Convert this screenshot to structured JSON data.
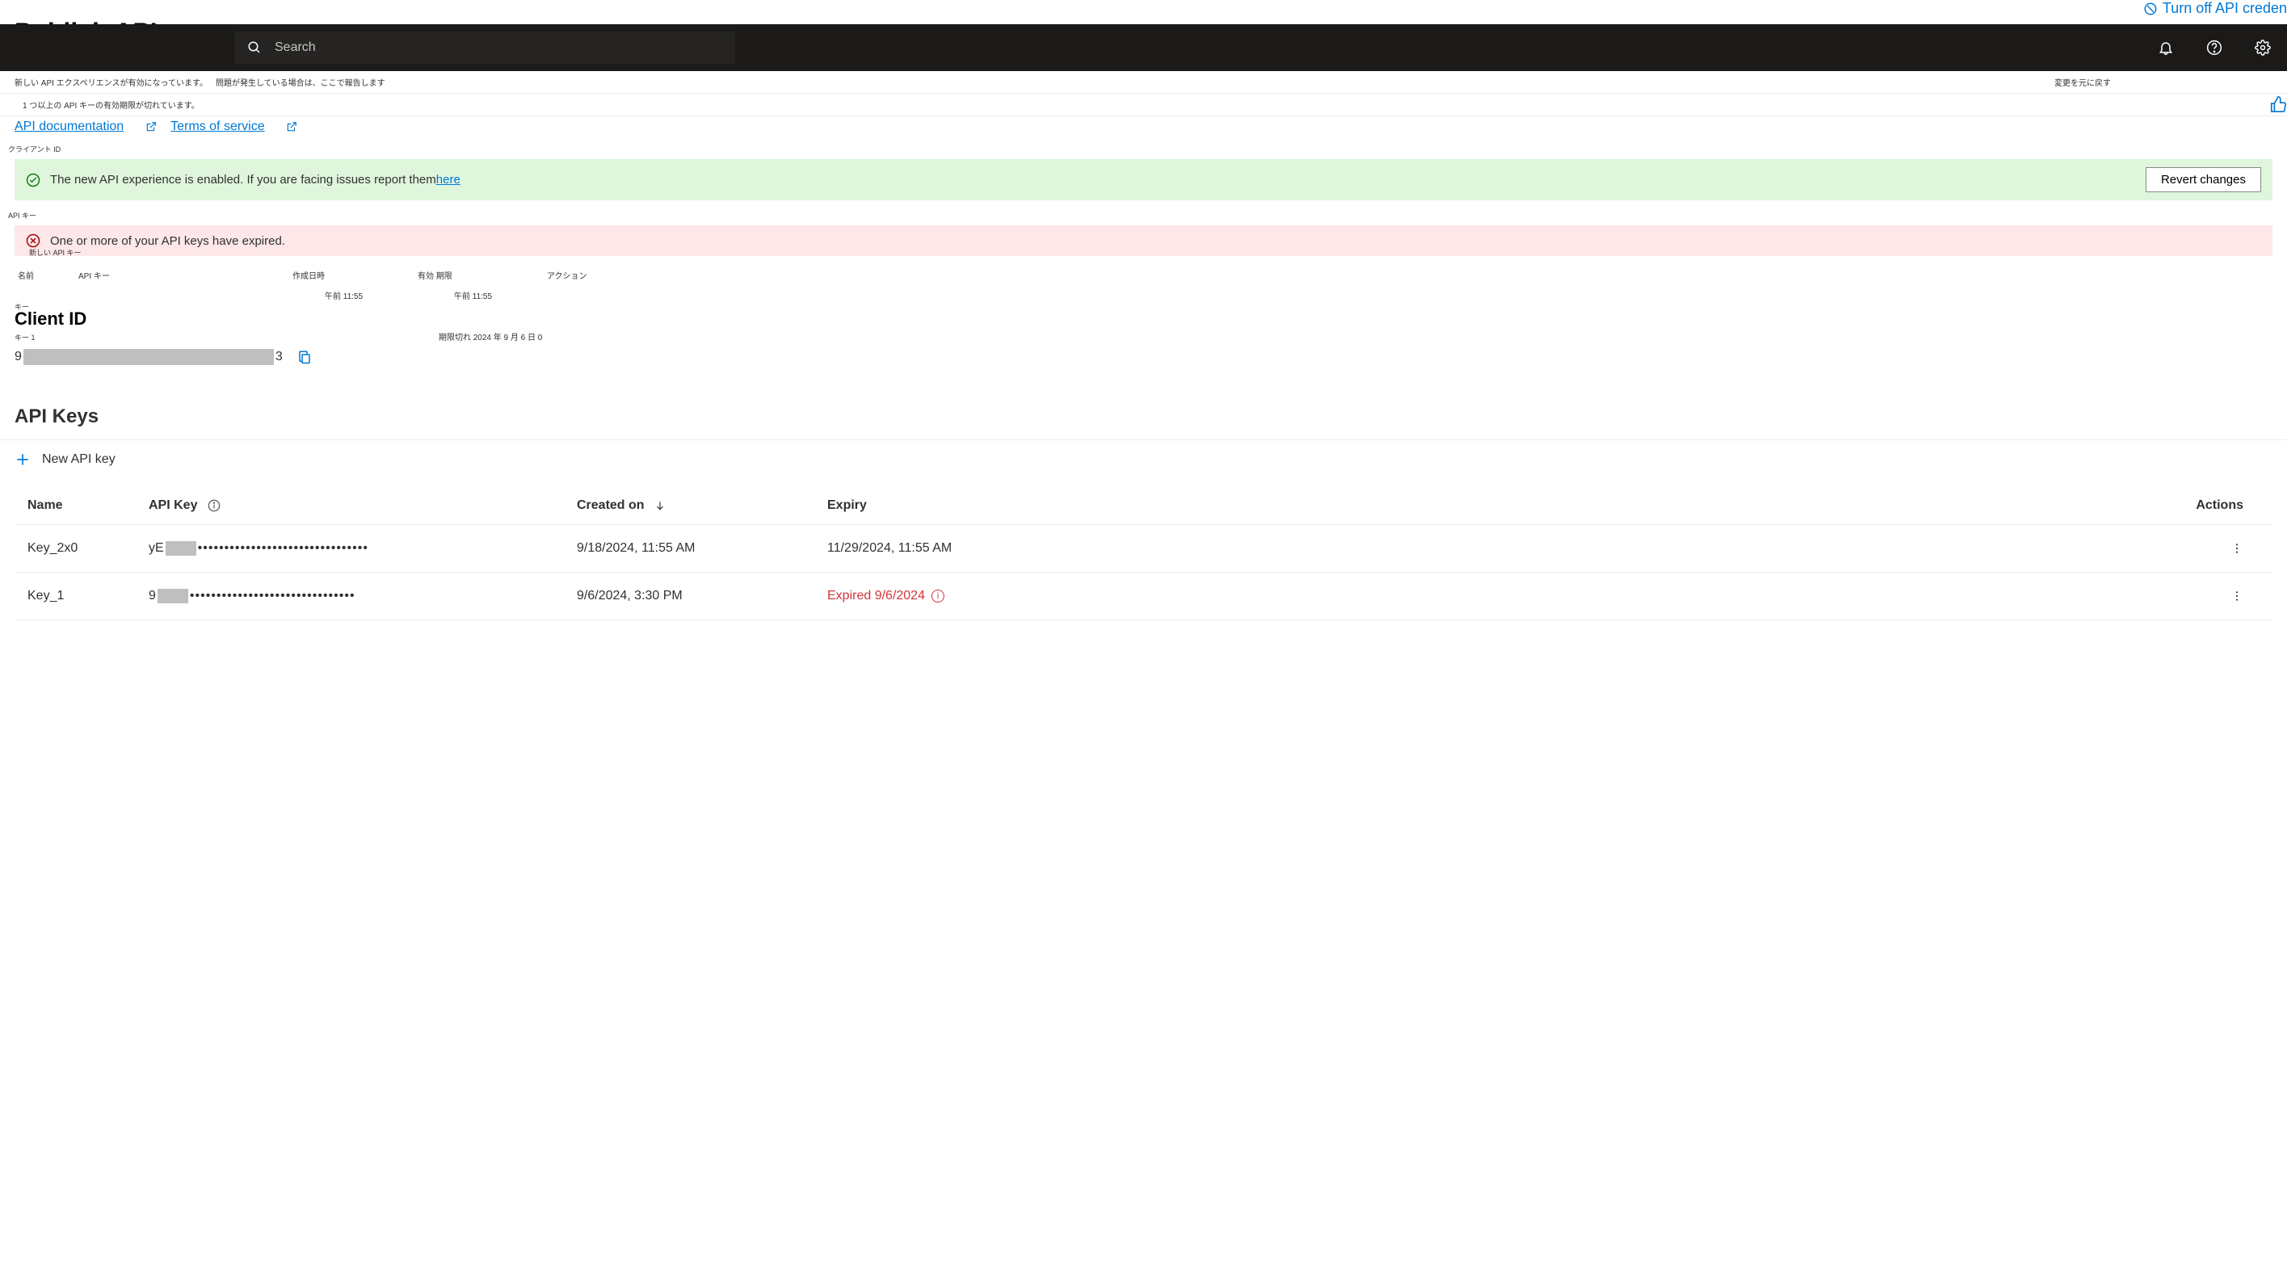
{
  "pageTitlePartial": "Publish API",
  "turnOffPartial": "Turn off API creden",
  "search": {
    "placeholder": "Search"
  },
  "jpBars": {
    "text1": "新しい API エクスペリエンスが有効になっています。",
    "text2": "問題が発生している場合は、ここで報告します",
    "revert": "変更を元に戻す",
    "expired": "1 つ以上の API キーの有効期限が切れています。"
  },
  "links": {
    "apiDoc": "API documentation",
    "tos": "Terms of service"
  },
  "jpLabels": {
    "clientId": "クライアント ID",
    "apiKey": "API キー",
    "newApiKey": "新しい API キー",
    "name": "名前",
    "key": "API キー",
    "created": "作成日時",
    "expiry": "有効 期限",
    "actions": "アクション",
    "keyLabel": "キー",
    "key1": "キー 1",
    "time": "午前 11:55",
    "expiredAt": "期限切れ 2024 年 9 月 6 日 0"
  },
  "successBanner": {
    "text": "The new API experience is enabled. If you are facing issues report them ",
    "link": "here",
    "revertBtn": "Revert changes"
  },
  "errorBanner": {
    "text": "One or more of your API keys have expired."
  },
  "clientId": {
    "heading": "Client ID",
    "prefix": "9",
    "suffix": "3"
  },
  "apiKeys": {
    "heading": "API Keys",
    "newBtn": "New API key",
    "columns": {
      "name": "Name",
      "key": "API Key",
      "created": "Created on",
      "expiry": "Expiry",
      "actions": "Actions"
    },
    "rows": [
      {
        "name": "Key_2x0",
        "keyPrefix": "yE",
        "dots": "••••••••••••••••••••••••••••••••",
        "created": "9/18/2024, 11:55 AM",
        "expiry": "11/29/2024, 11:55 AM",
        "expired": false
      },
      {
        "name": "Key_1",
        "keyPrefix": "9",
        "dots": "•••••••••••••••••••••••••••••••",
        "created": "9/6/2024, 3:30 PM",
        "expiry": "Expired 9/6/2024",
        "expired": true
      }
    ]
  }
}
